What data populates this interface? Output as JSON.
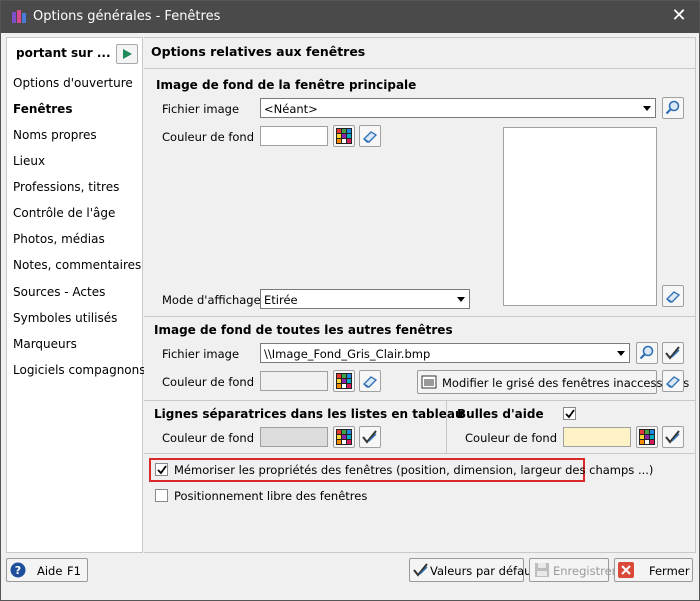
{
  "window": {
    "title": "Options générales - Fenêtres",
    "close_glyph": "✕"
  },
  "sidebar": {
    "header": "portant sur ...",
    "items": [
      {
        "label": "Options d'ouverture"
      },
      {
        "label": "Fenêtres"
      },
      {
        "label": "Noms propres"
      },
      {
        "label": "Lieux"
      },
      {
        "label": "Professions, titres"
      },
      {
        "label": "Contrôle de l'âge"
      },
      {
        "label": "Photos, médias"
      },
      {
        "label": "Notes, commentaires"
      },
      {
        "label": "Sources - Actes"
      },
      {
        "label": "Symboles utilisés"
      },
      {
        "label": "Marqueurs"
      },
      {
        "label": "Logiciels compagnons"
      }
    ],
    "active_index": 1
  },
  "main": {
    "title": "Options relatives aux fenêtres",
    "section_main_bg": {
      "heading": "Image de fond de la fenêtre principale",
      "file_label": "Fichier image",
      "file_value": "<Néant>",
      "color_label": "Couleur de fond",
      "color_value": "#ffffff",
      "mode_label": "Mode d'affichage",
      "mode_value": "Etirée"
    },
    "section_other_bg": {
      "heading": "Image de fond de toutes les autres fenêtres",
      "file_label": "Fichier image",
      "file_value": "\\\\Image_Fond_Gris_Clair.bmp",
      "color_label": "Couleur de fond",
      "color_value": "#f0f0f0",
      "modify_button": "Modifier le grisé des fenêtres inaccessibles"
    },
    "section_lines": {
      "heading": "Lignes séparatrices dans les listes en tableau",
      "color_label": "Couleur de fond",
      "color_value": "#dcdcdc"
    },
    "section_tooltips": {
      "heading": "Bulles d'aide",
      "enabled": true,
      "color_label": "Couleur de fond",
      "color_value": "#fdf1c6"
    },
    "memorize": {
      "label": "Mémoriser les propriétés des fenêtres (position, dimension, largeur des champs ...)",
      "checked": true
    },
    "free_position": {
      "label": "Positionnement libre des fenêtres",
      "checked": false
    }
  },
  "footer": {
    "help_label": "Aide",
    "help_key": "F1",
    "defaults_label": "Valeurs par défaut",
    "save_label": "Enregistrer",
    "close_label": "Fermer"
  },
  "colors": {
    "titlebar": "#4a4a4a",
    "highlight_border": "#d92a2a",
    "accent_green": "#1f8a5c"
  }
}
